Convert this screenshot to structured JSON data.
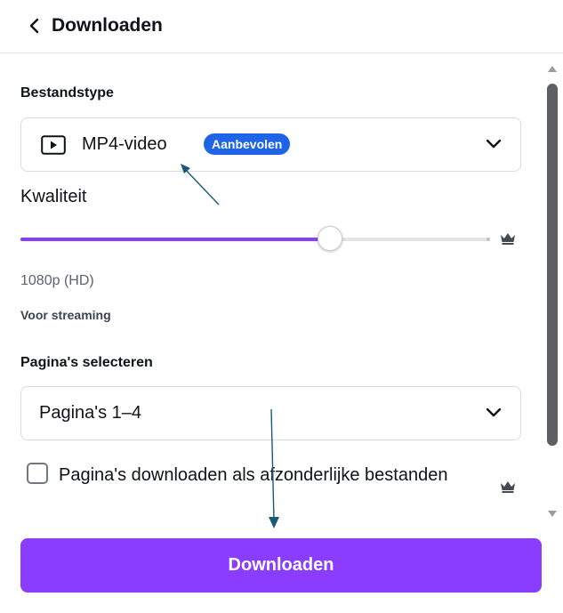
{
  "header": {
    "title": "Downloaden",
    "back_icon": "chevron-left-icon"
  },
  "file_type": {
    "label": "Bestandstype",
    "selected_value": "MP4-video",
    "selected_icon": "video-play-icon",
    "badge": "Aanbevolen",
    "dropdown_icon": "chevron-down-icon"
  },
  "quality": {
    "label": "Kwaliteit",
    "value_text": "1080p (HD)",
    "note": "Voor streaming",
    "slider_level_fraction": 0.66,
    "premium_icon": "crown-icon"
  },
  "pages": {
    "label": "Pagina's selecteren",
    "selected_value": "Pagina's 1–4",
    "dropdown_icon": "chevron-down-icon"
  },
  "separate_files": {
    "label": "Pagina's downloaden als afzonderlijke bestanden",
    "checked": false,
    "premium_icon": "crown-icon"
  },
  "download_button": {
    "label": "Downloaden"
  },
  "colors": {
    "accent": "#8b3dff",
    "badge_blue": "#1f64e6",
    "annotation_arrow": "#1a5a78"
  }
}
